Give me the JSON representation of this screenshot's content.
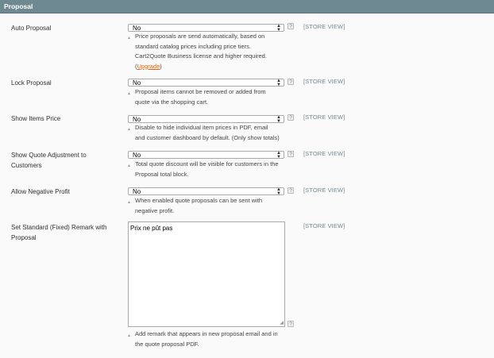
{
  "section": {
    "title": "Proposal"
  },
  "rows": [
    {
      "label": "Auto Proposal",
      "value": "No",
      "scope": "[STORE VIEW]",
      "note_lines": [
        "Price proposals are send automatically, based on",
        "standard catalog prices including price tiers.",
        "Cart2Quote Business license and higher required."
      ],
      "upgrade_prefix": "(",
      "upgrade_link": "Upgrade",
      "upgrade_suffix": ")"
    },
    {
      "label": "Lock Proposal",
      "value": "No",
      "scope": "[STORE VIEW]",
      "note_lines": [
        "Proposal items cannot be removed or added from",
        "quote via the shopping cart."
      ]
    },
    {
      "label": "Show Items Price",
      "value": "No",
      "scope": "[STORE VIEW]",
      "note_lines": [
        "Disable to hide individual item prices in PDF, email",
        "and customer dashboard by default. (Only show totals)"
      ]
    },
    {
      "label_lines": [
        "Show Quote Adjustment to",
        "Customers"
      ],
      "value": "No",
      "scope": "[STORE VIEW]",
      "note_lines": [
        "Total quote discount will be visible for customers in the",
        "Proposal total block."
      ]
    },
    {
      "label": "Allow Negative Profit",
      "value": "No",
      "scope": "[STORE VIEW]",
      "note_lines": [
        "When enabled quote proposals can be sent with",
        "negative profit."
      ]
    },
    {
      "label_lines": [
        "Set Standard (Fixed) Remark with",
        "Proposal"
      ],
      "value": "Prix ne pût pas",
      "scope": "[STORE VIEW]",
      "note_lines": [
        "Add remark that appears in new proposal email and in",
        "the quote proposal PDF."
      ]
    }
  ],
  "icons": {
    "help": "question-help-icon",
    "select_arrows": "up-down-arrows-icon",
    "note_marker": "triangle-up-icon",
    "resize": "resize-grip-icon"
  },
  "glyphs": {
    "help": "?",
    "arrows_up": "▲",
    "arrows_down": "▼",
    "tri": "▲",
    "grip": "◢"
  },
  "colors": {
    "header_bg": "#6f8992",
    "scope_text": "#6f8992",
    "link": "#eb5e00",
    "panel_bg": "#fafafa"
  }
}
